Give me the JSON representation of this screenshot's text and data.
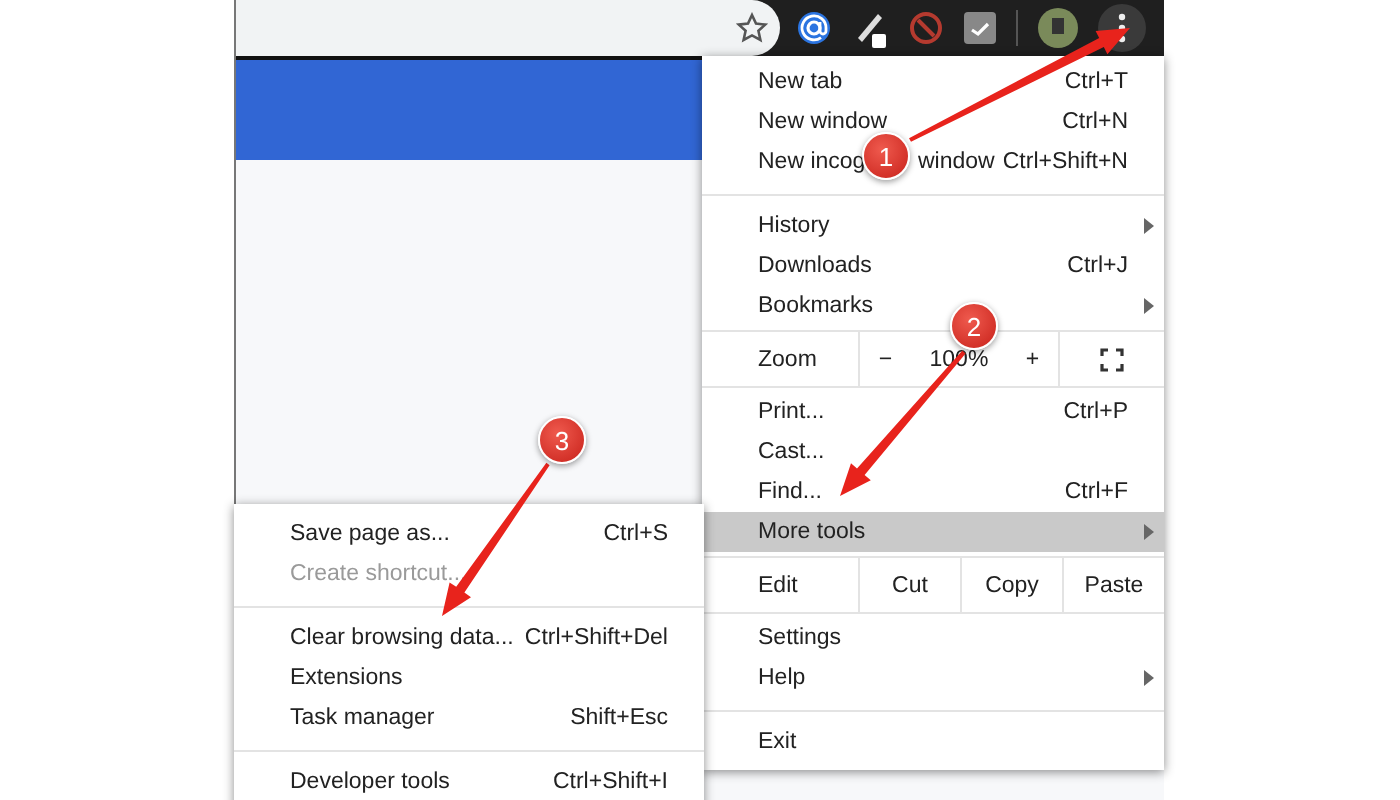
{
  "menu": {
    "items": [
      {
        "kind": "item",
        "label": "New tab",
        "shortcut": "Ctrl+T",
        "highlighted": false,
        "disabled": false
      },
      {
        "kind": "item",
        "label": "New window",
        "shortcut": "Ctrl+N",
        "highlighted": false,
        "disabled": false
      },
      {
        "kind": "item",
        "label": "New incog",
        "label_rest": "window",
        "shortcut": "Ctrl+Shift+N",
        "highlighted": false,
        "disabled": false
      },
      {
        "kind": "divider"
      },
      {
        "kind": "item",
        "label": "History",
        "submenu": true,
        "highlighted": false,
        "disabled": false
      },
      {
        "kind": "item",
        "label": "Downloads",
        "shortcut": "Ctrl+J",
        "highlighted": false,
        "disabled": false
      },
      {
        "kind": "item",
        "label": "Bookmarks",
        "submenu": true,
        "highlighted": false,
        "disabled": false
      },
      {
        "kind": "zoom",
        "label": "Zoom",
        "minus": "−",
        "value": "100%",
        "plus": "+"
      },
      {
        "kind": "item",
        "label": "Print...",
        "shortcut": "Ctrl+P",
        "highlighted": false,
        "disabled": false
      },
      {
        "kind": "item",
        "label": "Cast...",
        "highlighted": false,
        "disabled": false
      },
      {
        "kind": "item",
        "label": "Find...",
        "shortcut": "Ctrl+F",
        "highlighted": false,
        "disabled": false
      },
      {
        "kind": "item",
        "label": "More tools",
        "submenu": true,
        "highlighted": true,
        "disabled": false
      },
      {
        "kind": "edit",
        "label": "Edit",
        "buttons": [
          "Cut",
          "Copy",
          "Paste"
        ]
      },
      {
        "kind": "item",
        "label": "Settings",
        "highlighted": false,
        "disabled": false
      },
      {
        "kind": "item",
        "label": "Help",
        "submenu": true,
        "highlighted": false,
        "disabled": false
      },
      {
        "kind": "divider"
      },
      {
        "kind": "item",
        "label": "Exit",
        "highlighted": false,
        "disabled": false
      }
    ]
  },
  "submenu": {
    "items": [
      {
        "kind": "item",
        "label": "Save page as...",
        "shortcut": "Ctrl+S",
        "highlighted": false,
        "disabled": false
      },
      {
        "kind": "item",
        "label": "Create shortcut...",
        "highlighted": false,
        "disabled": true
      },
      {
        "kind": "divider"
      },
      {
        "kind": "item",
        "label": "Clear browsing data...",
        "shortcut": "Ctrl+Shift+Del",
        "highlighted": false,
        "disabled": false
      },
      {
        "kind": "item",
        "label": "Extensions",
        "highlighted": false,
        "disabled": false
      },
      {
        "kind": "item",
        "label": "Task manager",
        "shortcut": "Shift+Esc",
        "highlighted": false,
        "disabled": false
      },
      {
        "kind": "divider"
      },
      {
        "kind": "item",
        "label": "Developer tools",
        "shortcut": "Ctrl+Shift+I",
        "highlighted": false,
        "disabled": false
      }
    ]
  },
  "annotations": [
    {
      "label": "1"
    },
    {
      "label": "2"
    },
    {
      "label": "3"
    }
  ]
}
